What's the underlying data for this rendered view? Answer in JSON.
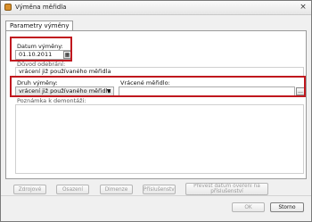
{
  "window": {
    "title": "Výměna měřidla",
    "close_glyph": "×"
  },
  "tab": {
    "label": "Parametry výměny"
  },
  "fields": {
    "datum_vymeny": {
      "label": "Datum výměny:",
      "value": "01.10.2011"
    },
    "duvod_odebrani": {
      "label": "Důvod odebrání:",
      "value": "vrácení již používaného měřidla"
    },
    "druh_vymeny": {
      "label": "Druh výměny:",
      "value": "vrácení již používaného měřidla"
    },
    "vracene_meridlo": {
      "label": "Vrácené měřidlo:",
      "value": "",
      "browse_glyph": "..."
    },
    "poznamka": {
      "label": "Poznámka k demontáži:",
      "value": ""
    }
  },
  "buttons": {
    "zdrojove": "Zdrojové",
    "osazeni": "Osazení",
    "dimenze": "Dimenze",
    "prislusenstvi": "Příslušenství",
    "prevest": "Převést datum ověření na příslušenství",
    "ok": "OK",
    "storno": "Storno"
  },
  "icons": {
    "app": "meter-app-icon",
    "calendar": "calendar-icon",
    "dropdown": "chevron-down-icon",
    "close": "close-icon"
  }
}
